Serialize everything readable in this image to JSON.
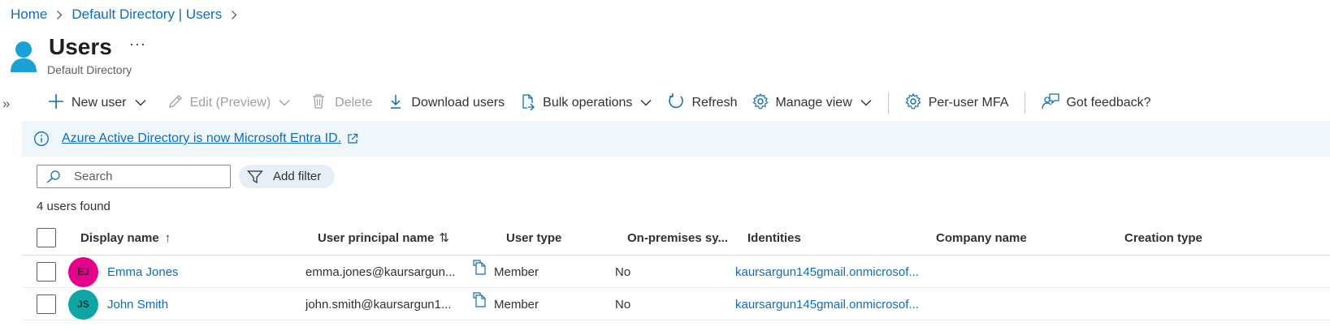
{
  "breadcrumb": {
    "home": "Home",
    "directory": "Default Directory | Users"
  },
  "page": {
    "title": "Users",
    "more": "···",
    "subtitle": "Default Directory"
  },
  "toolbar": {
    "new_user": "New user",
    "edit": "Edit (Preview)",
    "delete": "Delete",
    "download": "Download users",
    "bulk": "Bulk operations",
    "refresh": "Refresh",
    "manage_view": "Manage view",
    "mfa": "Per-user MFA",
    "feedback": "Got feedback?"
  },
  "banner": {
    "text": "Azure Active Directory is now Microsoft Entra ID."
  },
  "search": {
    "placeholder": "Search",
    "value": ""
  },
  "filter": {
    "label": "Add filter"
  },
  "results": {
    "count_text": "4 users found"
  },
  "table": {
    "columns": {
      "display_name": "Display name",
      "display_name_sort": "↑",
      "upn": "User principal name",
      "upn_sort": "⇅",
      "user_type": "User type",
      "on_prem": "On-premises sy...",
      "identities": "Identities",
      "company": "Company name",
      "creation": "Creation type"
    },
    "rows": [
      {
        "initials": "EJ",
        "avatar_color": "#e3008c",
        "name": "Emma Jones",
        "upn": "emma.jones@kaursargun...",
        "user_type": "Member",
        "on_prem": "No",
        "identities": "kaursargun145gmail.onmicrosof...",
        "company": "",
        "creation": ""
      },
      {
        "initials": "JS",
        "avatar_color": "#0ea5a4",
        "name": "John Smith",
        "upn": "john.smith@kaursargun1...",
        "user_type": "Member",
        "on_prem": "No",
        "identities": "kaursargun145gmail.onmicrosof...",
        "company": "",
        "creation": ""
      }
    ]
  },
  "colors": {
    "accent": "#0f6cbd",
    "banner_bg": "#eff6fc",
    "user_icon": "#1aa1d6"
  }
}
